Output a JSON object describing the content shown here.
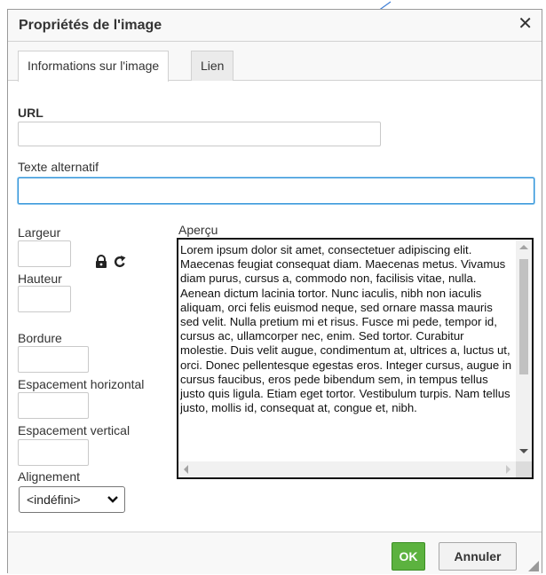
{
  "dialog": {
    "title": "Propriétés de l'image",
    "close_symbol": "✕"
  },
  "tabs": [
    {
      "label": "Informations sur l'image",
      "active": true
    },
    {
      "label": "Lien",
      "active": false
    }
  ],
  "form": {
    "url_label": "URL",
    "url_value": "",
    "alt_label": "Texte alternatif",
    "alt_value": "",
    "width_label": "Largeur",
    "height_label": "Hauteur",
    "border_label": "Bordure",
    "hspace_label": "Espacement horizontal",
    "vspace_label": "Espacement vertical",
    "align_label": "Alignement",
    "align_selected": "<indéfini>",
    "preview_label": "Aperçu",
    "preview_text": "Lorem ipsum dolor sit amet, consectetuer adipiscing elit. Maecenas feugiat consequat diam. Maecenas metus. Vivamus diam purus, cursus a, commodo non, facilisis vitae, nulla. Aenean dictum lacinia tortor. Nunc iaculis, nibh non iaculis aliquam, orci felis euismod neque, sed ornare massa mauris sed velit. Nulla pretium mi et risus. Fusce mi pede, tempor id, cursus ac, ullamcorper nec, enim. Sed tortor. Curabitur molestie. Duis velit augue, condimentum at, ultrices a, luctus ut, orci. Donec pellentesque egestas eros. Integer cursus, augue in cursus faucibus, eros pede bibendum sem, in tempus tellus justo quis ligula. Etiam eget tortor. Vestibulum turpis. Nam tellus justo, mollis id, consequat at, congue et, nibh."
  },
  "buttons": {
    "ok_label": "OK",
    "cancel_label": "Annuler"
  },
  "colors": {
    "ok_green": "#5cb23f",
    "focus_blue": "#2a8fd6",
    "annotation_arrow": "#3f7fd6"
  },
  "icons": {
    "lock": "lock-icon",
    "reset": "reset-size-icon",
    "close": "close-icon"
  }
}
